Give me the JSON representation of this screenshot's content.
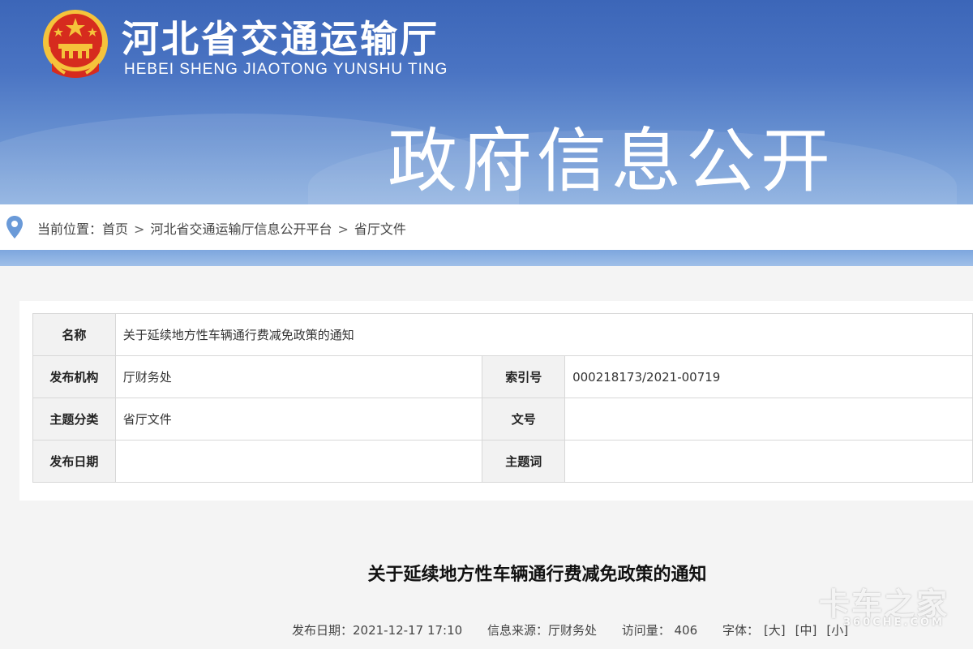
{
  "header": {
    "site_name": "河北省交通运输厅",
    "site_pinyin": "HEBEI SHENG JIAOTONG YUNSHU TING",
    "banner_title": "政府信息公开"
  },
  "breadcrumb": {
    "prefix": "当前位置：",
    "items": [
      "首页",
      "河北省交通运输厅信息公开平台",
      "省厅文件"
    ],
    "separator": ">"
  },
  "info_table": {
    "name_label": "名称",
    "name_value": "关于延续地方性车辆通行费减免政策的通知",
    "publisher_label": "发布机构",
    "publisher_value": "厅财务处",
    "index_label": "索引号",
    "index_value": "000218173/2021-00719",
    "category_label": "主题分类",
    "category_value": "省厅文件",
    "docno_label": "文号",
    "docno_value": "",
    "date_label": "发布日期",
    "date_value": "",
    "keyword_label": "主题词",
    "keyword_value": ""
  },
  "article": {
    "title": "关于延续地方性车辆通行费减免政策的通知",
    "meta_date": "发布日期：2021-12-17 17:10",
    "meta_source": "信息来源：厅财务处",
    "meta_views": "访问量：  406",
    "font_label": "字体：",
    "font_large": "[大]",
    "font_medium": "[中]",
    "font_small": "[小]"
  },
  "watermark": {
    "text": "卡车之家",
    "sub": "360CHE.COM"
  },
  "colors": {
    "banner_blue": "#3c66b8",
    "label_bg": "#f2f2f2",
    "border": "#d8d8d8"
  }
}
